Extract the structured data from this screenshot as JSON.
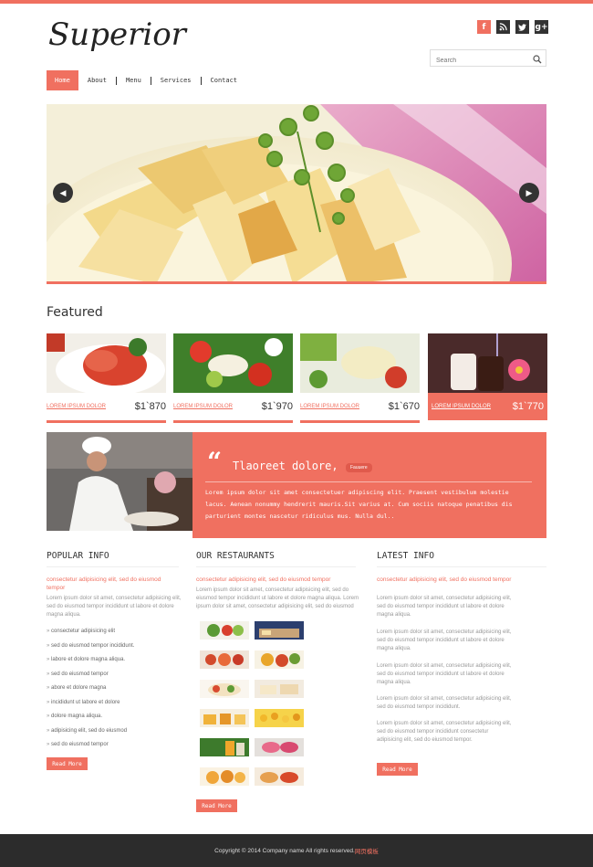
{
  "header": {
    "logo_text": "Superior",
    "social_icons": [
      {
        "name": "facebook-icon",
        "glyph": "f",
        "color": "#f07060"
      },
      {
        "name": "rss-icon",
        "glyph": "◕",
        "color": "#333333"
      },
      {
        "name": "twitter-icon",
        "glyph": "t",
        "color": "#333333"
      },
      {
        "name": "googleplus-icon",
        "glyph": "g+",
        "color": "#333333"
      }
    ],
    "search_placeholder": "Search"
  },
  "nav": {
    "items": [
      "Home",
      "About",
      "Menu",
      "Services",
      "Contact"
    ],
    "active": "Home"
  },
  "slider": {
    "prev_glyph": "◀",
    "next_glyph": "▶"
  },
  "featured": {
    "title": "Featured",
    "items": [
      {
        "label": "LOREM IPSUM DOLOR",
        "price": "$1`870"
      },
      {
        "label": "LOREM IPSUM DOLOR",
        "price": "$1`970"
      },
      {
        "label": "LOREM IPSUM DOLOR",
        "price": "$1`670"
      },
      {
        "label": "LOREM IPSUM DOLOR",
        "price": "$1`770"
      }
    ]
  },
  "quote": {
    "title": "Tlaoreet dolore,",
    "tag": "Fauuere",
    "text": "Lorem ipsum dolor sit amet consectetuer adipiscing elit. Praesent vestibulum molestie lacus. Aenean nonummy hendrerit mauris.Sit varius at. Cum sociis natoque penatibus dis parturient montes nascetur ridiculus mus. Nulla dul.."
  },
  "popular": {
    "title": "POPULAR INFO",
    "subtitle": "consectetur adipisicing elit, sed do eiusmod tempor",
    "para": "Lorem ipsum dolor sit amet, consectetur adipisicing elit, sed do eiusmod tempor incididunt ut labore et dolore magna aliqua.",
    "list": [
      "consectetur adipisicing elit",
      "sed do eiusmod tempor incididunt.",
      "labore et dolore magna aliqua.",
      "sed do eiusmod tempor",
      "abore et dolore magna",
      "incididunt ut labore et dolore",
      "dolore magna aliqua.",
      "adipisicing elit, sed do eiusmod",
      "sed do eiusmod tempor"
    ],
    "button": "Read More"
  },
  "restaurants": {
    "title": "OUR RESTAURANTS",
    "subtitle": "consectetur adipisicing elit, sed do eiusmod tempor",
    "para": "Lorem ipsum dolor sit amet, consectetur adipisicing elit, sed do eiusmod tempor incididunt ut labore et dolore magna aliqua. Lorem ipsum dolor sit amet, consectetur adipisicing elit, sed do eiusmod",
    "button": "Read More"
  },
  "latest": {
    "title": "LATEST INFO",
    "subtitle": "consectetur adipisicing elit, sed do eiusmod tempor",
    "paras": [
      "Lorem ipsum dolor sit amet, consectetur adipisicing elit, sed do eiusmod tempor incididunt ut labore et dolore magna aliqua.",
      "Lorem ipsum dolor sit amet, consectetur adipisicing elit, sed do eiusmod tempor incididunt ut labore et dolore magna aliqua.",
      "Lorem ipsum dolor sit amet, consectetur adipisicing elit, sed do eiusmod tempor incididunt ut labore et dolore magna aliqua.",
      "Lorem ipsum dolor sit amet, consectetur adipisicing elit, sed do eiusmod tempor incididunt.",
      "Lorem ipsum dolor sit amet, consectetur adipisicing elit, sed do eiusmod tempor incididunt consectetur adipisicing elit, sed do eiusmod tempor."
    ],
    "button": "Read More"
  },
  "footer": {
    "text": "Copyright © 2014 Company name All rights reserved.",
    "accent": "网页模板"
  },
  "colors": {
    "accent": "#f07060",
    "footer_bg": "#2c2c2c"
  }
}
